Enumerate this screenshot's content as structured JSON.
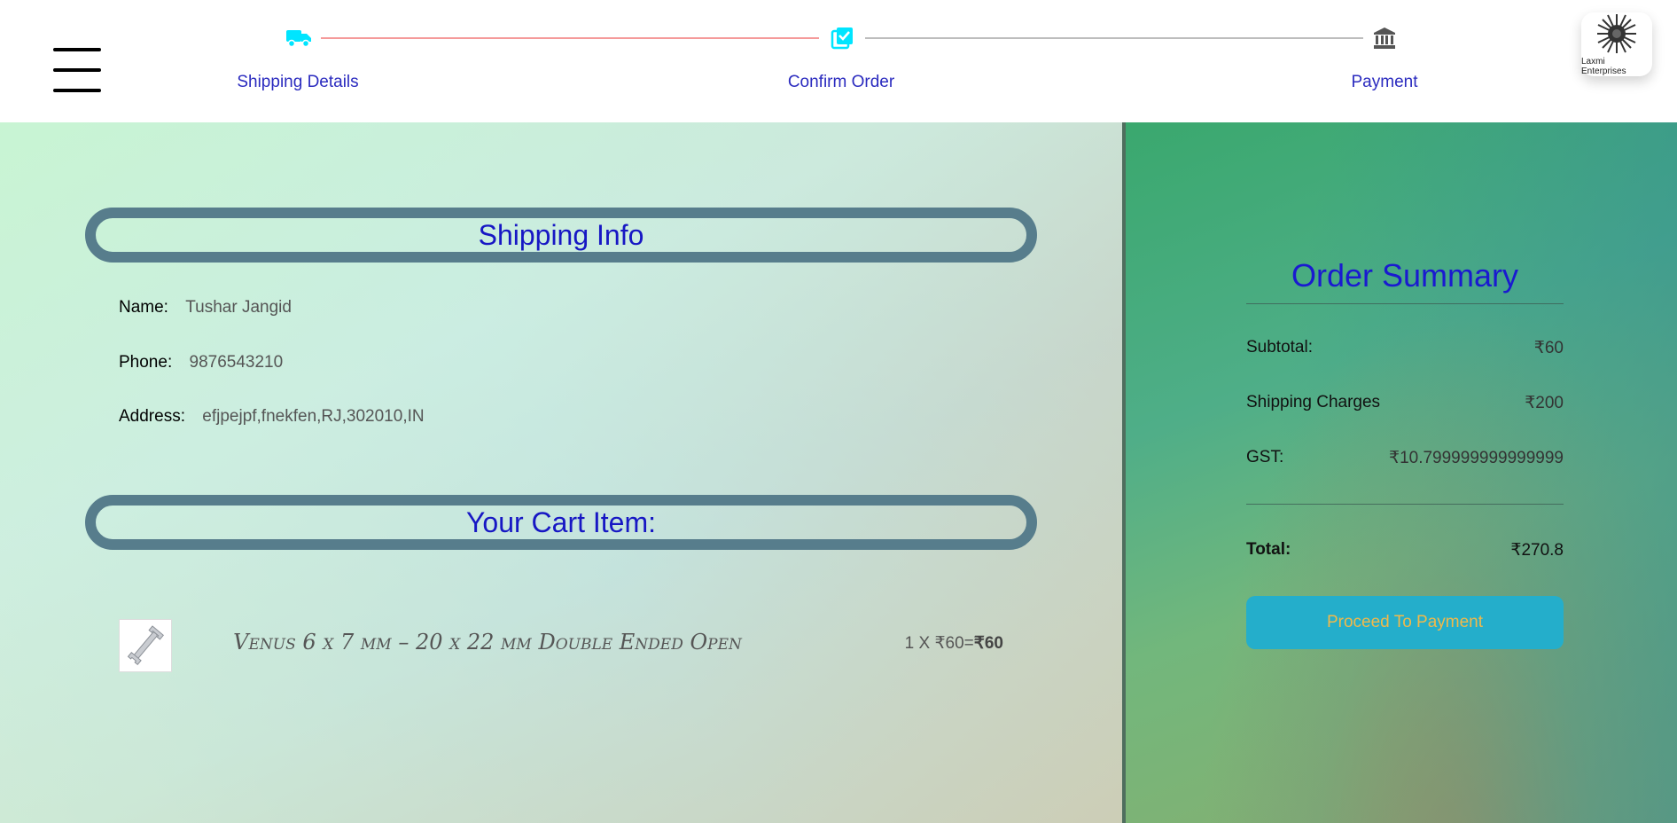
{
  "stepper": {
    "steps": [
      {
        "label": "Shipping Details",
        "icon": "truck-icon",
        "active": true
      },
      {
        "label": "Confirm Order",
        "icon": "checklist-icon",
        "active": true
      },
      {
        "label": "Payment",
        "icon": "bank-icon",
        "active": false
      }
    ],
    "active_color": "#00e5ff",
    "active_line_color": "#f59a9a",
    "inactive_line_color": "#bdbdbd"
  },
  "brand": {
    "name": "Laxmi Enterprises"
  },
  "shipping": {
    "heading": "Shipping Info",
    "name_label": "Name:",
    "name_value": "Tushar Jangid",
    "phone_label": "Phone:",
    "phone_value": "9876543210",
    "address_label": "Address:",
    "address_value": "efjpejpf,fnekfen,RJ,302010,IN"
  },
  "cart": {
    "heading": "Your Cart Item:",
    "items": [
      {
        "name": "Venus 6 x 7 mm – 20 x 22 mm Double Ended Open",
        "price_expr": "1 X ₹60=",
        "line_total": "₹60",
        "thumb_icon": "wrench-icon"
      }
    ]
  },
  "summary": {
    "title": "Order Summary",
    "subtotal_label": "Subtotal:",
    "subtotal_value": "₹60",
    "shipping_label": "Shipping Charges",
    "shipping_value": "₹200",
    "gst_label": "GST:",
    "gst_value": "₹10.799999999999999",
    "total_label": "Total:",
    "total_value": "₹270.8",
    "button_label": "Proceed To Payment"
  },
  "colors": {
    "heading_blue": "#1a1ad0",
    "pill_border": "#577d8c",
    "button_bg": "#24aecb",
    "button_text": "#f1b94a"
  }
}
